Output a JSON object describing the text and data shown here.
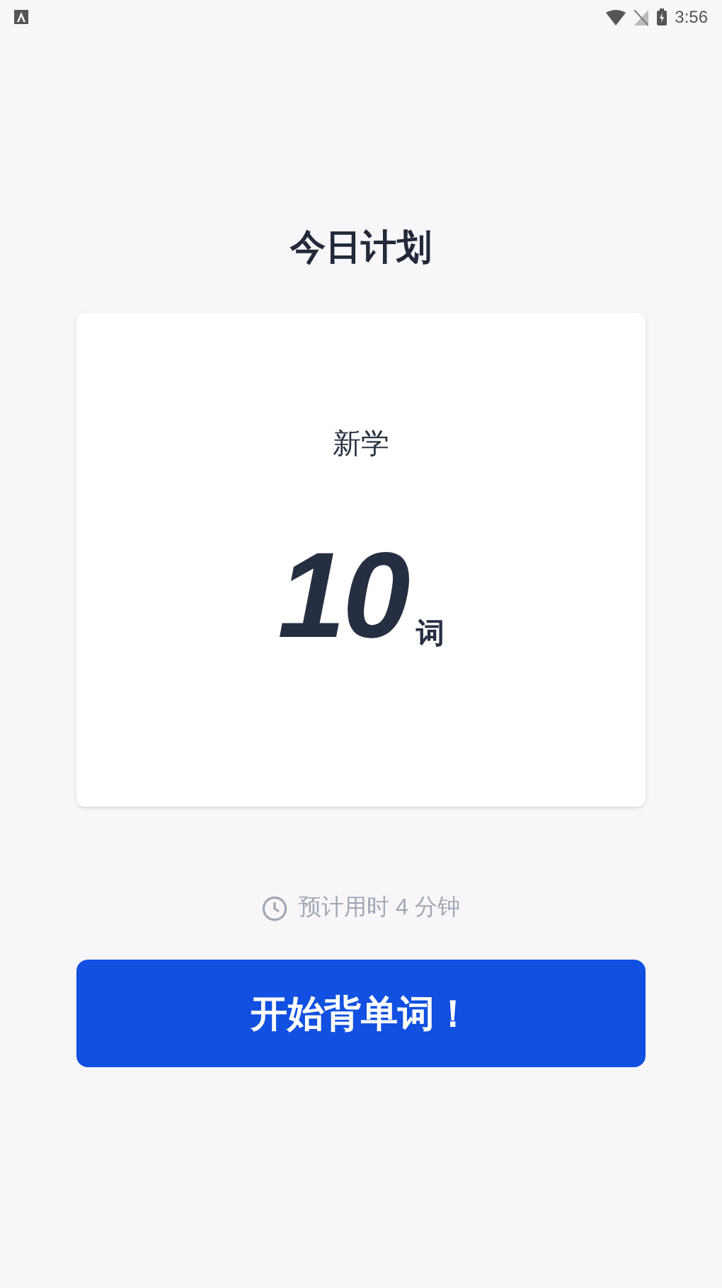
{
  "status_bar": {
    "time": "3:56"
  },
  "title": "今日计划",
  "plan_card": {
    "label": "新学",
    "count": "10",
    "unit": "词"
  },
  "estimate": "预计用时 4 分钟",
  "start_button": {
    "label": "开始背单词！"
  }
}
